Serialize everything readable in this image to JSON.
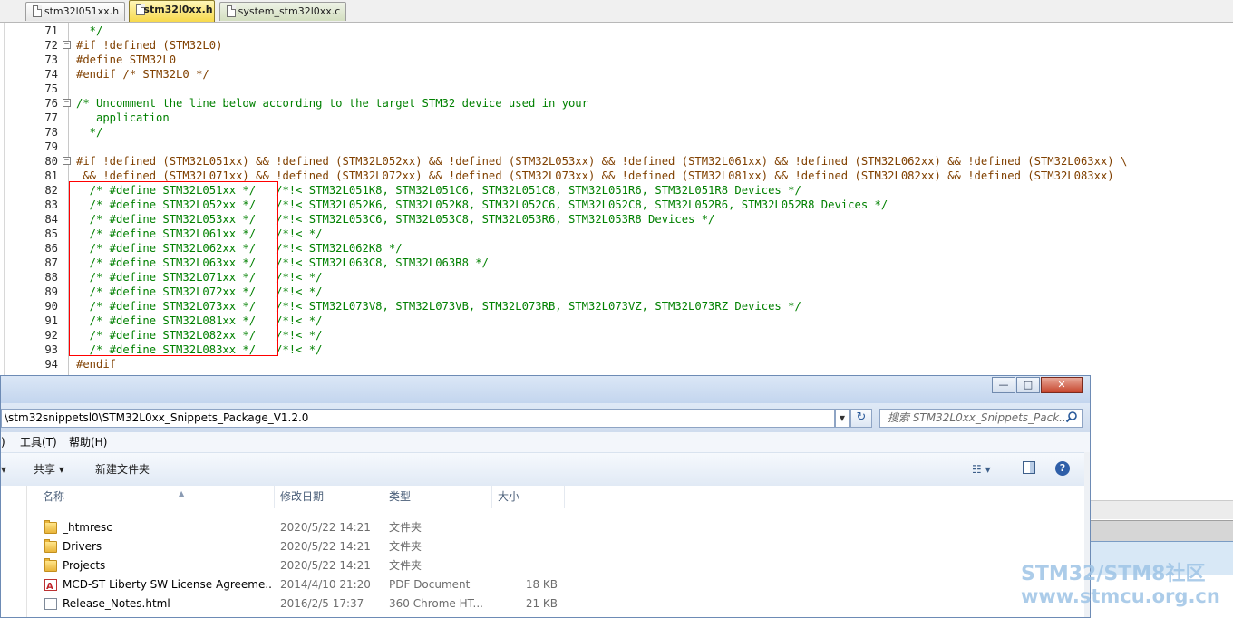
{
  "tabs": [
    {
      "label": "stm32l051xx.h",
      "active": false
    },
    {
      "label": "stm32l0xx.h",
      "active": true
    },
    {
      "label": "system_stm32l0xx.c",
      "active": false
    }
  ],
  "code_lines": [
    {
      "n": "71",
      "fold": "",
      "text": "  */",
      "cls": "cm"
    },
    {
      "n": "72",
      "fold": "−",
      "text": "#if !defined (STM32L0)",
      "cls": "pp"
    },
    {
      "n": "73",
      "fold": "",
      "text": "#define STM32L0",
      "cls": "pp"
    },
    {
      "n": "74",
      "fold": "",
      "text": "#endif /* STM32L0 */",
      "cls": "pp"
    },
    {
      "n": "75",
      "fold": "",
      "text": "",
      "cls": "cm"
    },
    {
      "n": "76",
      "fold": "−",
      "text": "/* Uncomment the line below according to the target STM32 device used in your",
      "cls": "cm"
    },
    {
      "n": "77",
      "fold": "",
      "text": "   application",
      "cls": "cm"
    },
    {
      "n": "78",
      "fold": "",
      "text": "  */",
      "cls": "cm"
    },
    {
      "n": "79",
      "fold": "",
      "text": "",
      "cls": "cm"
    },
    {
      "n": "80",
      "fold": "−",
      "text": "#if !defined (STM32L051xx) && !defined (STM32L052xx) && !defined (STM32L053xx) && !defined (STM32L061xx) && !defined (STM32L062xx) && !defined (STM32L063xx) \\",
      "cls": "pp"
    },
    {
      "n": "81",
      "fold": "",
      "text": " && !defined (STM32L071xx) && !defined (STM32L072xx) && !defined (STM32L073xx) && !defined (STM32L081xx) && !defined (STM32L082xx) && !defined (STM32L083xx)",
      "cls": "pp"
    },
    {
      "n": "82",
      "fold": "",
      "text": "  /* #define STM32L051xx */   /*!< STM32L051K8, STM32L051C6, STM32L051C8, STM32L051R6, STM32L051R8 Devices */",
      "cls": "cm"
    },
    {
      "n": "83",
      "fold": "",
      "text": "  /* #define STM32L052xx */   /*!< STM32L052K6, STM32L052K8, STM32L052C6, STM32L052C8, STM32L052R6, STM32L052R8 Devices */",
      "cls": "cm"
    },
    {
      "n": "84",
      "fold": "",
      "text": "  /* #define STM32L053xx */   /*!< STM32L053C6, STM32L053C8, STM32L053R6, STM32L053R8 Devices */",
      "cls": "cm"
    },
    {
      "n": "85",
      "fold": "",
      "text": "  /* #define STM32L061xx */   /*!< */",
      "cls": "cm"
    },
    {
      "n": "86",
      "fold": "",
      "text": "  /* #define STM32L062xx */   /*!< STM32L062K8 */",
      "cls": "cm"
    },
    {
      "n": "87",
      "fold": "",
      "text": "  /* #define STM32L063xx */   /*!< STM32L063C8, STM32L063R8 */",
      "cls": "cm"
    },
    {
      "n": "88",
      "fold": "",
      "text": "  /* #define STM32L071xx */   /*!< */",
      "cls": "cm"
    },
    {
      "n": "89",
      "fold": "",
      "text": "  /* #define STM32L072xx */   /*!< */",
      "cls": "cm"
    },
    {
      "n": "90",
      "fold": "",
      "text": "  /* #define STM32L073xx */   /*!< STM32L073V8, STM32L073VB, STM32L073RB, STM32L073VZ, STM32L073RZ Devices */",
      "cls": "cm"
    },
    {
      "n": "91",
      "fold": "",
      "text": "  /* #define STM32L081xx */   /*!< */",
      "cls": "cm"
    },
    {
      "n": "92",
      "fold": "",
      "text": "  /* #define STM32L082xx */   /*!< */",
      "cls": "cm"
    },
    {
      "n": "93",
      "fold": "",
      "text": "  /* #define STM32L083xx */   /*!< */",
      "cls": "cm"
    },
    {
      "n": "94",
      "fold": "",
      "text": "#endif",
      "cls": "pp"
    }
  ],
  "explorer": {
    "address": "\\stm32snippetsl0\\STM32L0xx_Snippets_Package_V1.2.0",
    "search_placeholder": "搜索 STM32L0xx_Snippets_Pack...",
    "window_controls": {
      "minimize": "—",
      "maximize": "□",
      "close": "✕"
    },
    "menu": [
      ")",
      "工具(T)",
      "帮助(H)"
    ],
    "toolbar": {
      "share": "共享 ▾",
      "new_folder": "新建文件夹"
    },
    "columns": {
      "name": "名称",
      "date": "修改日期",
      "type": "类型",
      "size": "大小"
    },
    "files": [
      {
        "name": "_htmresc",
        "date": "2020/5/22 14:21",
        "type": "文件夹",
        "size": "",
        "icon": "folder"
      },
      {
        "name": "Drivers",
        "date": "2020/5/22 14:21",
        "type": "文件夹",
        "size": "",
        "icon": "folder"
      },
      {
        "name": "Projects",
        "date": "2020/5/22 14:21",
        "type": "文件夹",
        "size": "",
        "icon": "folder"
      },
      {
        "name": "MCD-ST Liberty SW License Agreeme...",
        "date": "2014/4/10 21:20",
        "type": "PDF Document",
        "size": "18 KB",
        "icon": "pdf"
      },
      {
        "name": "Release_Notes.html",
        "date": "2016/2/5 17:37",
        "type": "360 Chrome HT...",
        "size": "21 KB",
        "icon": "html"
      }
    ]
  },
  "watermark": {
    "line1": "STM32/STM8社区",
    "line2": "www.stmcu.org.cn"
  },
  "colors": {
    "comment": "#008000",
    "preprocessor": "#804000",
    "highlight_box": "#ff0000",
    "watermark": "#9ec4e6"
  }
}
